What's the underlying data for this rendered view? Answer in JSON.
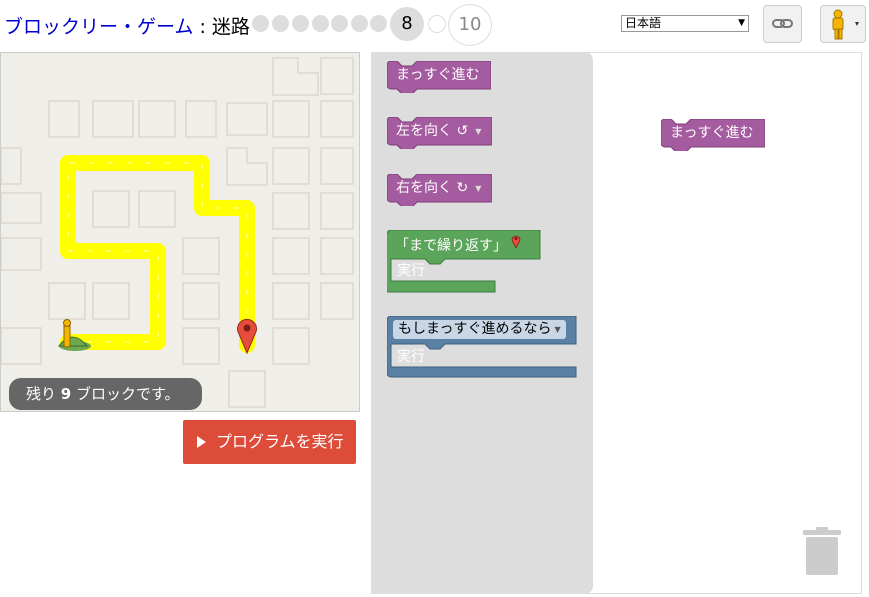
{
  "header": {
    "title_link": "ブロックリー・ゲーム",
    "title_separator": " : ",
    "title_page": "迷路",
    "levels": {
      "completed_count": 7,
      "current": "8",
      "last": "10"
    },
    "language": {
      "selected": "日本語"
    },
    "link_icon": "link-icon",
    "pegman_icon": "pegman-icon"
  },
  "maze": {
    "capacity_prefix": "残り ",
    "capacity_number": "9",
    "capacity_suffix": " ブロックです。",
    "run_label": "プログラムを実行",
    "colors": {
      "path": "#ffff00",
      "background": "#f0eee8",
      "marker": "#e74c3c",
      "start": "#6ea84f"
    }
  },
  "toolbox": {
    "move_forward": "まっすぐ進む",
    "turn_left": "左を向く ↺",
    "turn_right": "右を向く ↻",
    "repeat_until": "「まで繰り返す」",
    "repeat_do": "実行",
    "if_path": "もしまっすぐ進めるなら",
    "if_do": "実行",
    "colors": {
      "movement": "#a55b9f",
      "loop": "#5ba55b",
      "logic": "#5b80a5"
    }
  },
  "workspace": {
    "placed_block": "まっすぐ進む",
    "trash_icon": "trash-icon"
  }
}
